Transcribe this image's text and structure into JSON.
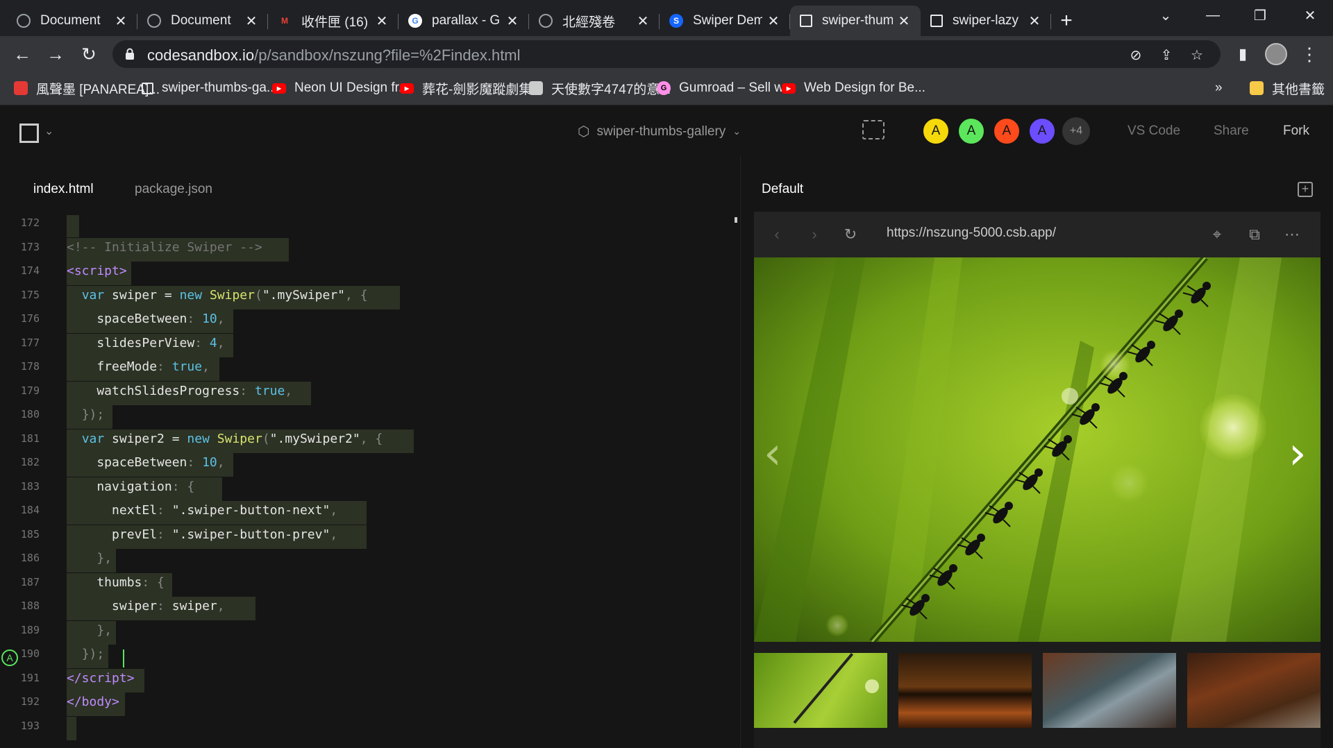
{
  "browser": {
    "tabs": [
      {
        "title": "Document",
        "icon": "globe-icon",
        "active": false
      },
      {
        "title": "Document",
        "icon": "globe-icon",
        "active": false
      },
      {
        "title": "收件匣 (16)",
        "icon": "gmail-icon",
        "active": false
      },
      {
        "title": "parallax - G",
        "icon": "google-icon",
        "active": false
      },
      {
        "title": "北經殘卷",
        "icon": "globe-icon",
        "active": false
      },
      {
        "title": "Swiper Dem",
        "icon": "swiper-icon",
        "active": false
      },
      {
        "title": "swiper-thum",
        "icon": "codesandbox-icon",
        "active": true
      },
      {
        "title": "swiper-lazy",
        "icon": "codesandbox-icon",
        "active": false
      }
    ],
    "url_host": "codesandbox.io",
    "url_path": "/p/sandbox/nszung?file=%2Findex.html",
    "bookmarks": [
      {
        "label": "風聲墨 [PANAREA]...",
        "icon": "panarea-icon",
        "color": "#e53935"
      },
      {
        "label": "swiper-thumbs-ga...",
        "icon": "codesandbox-icon",
        "color": "#e8eaed"
      },
      {
        "label": "Neon UI Design fr...",
        "icon": "youtube-icon",
        "color": "#ff0000"
      },
      {
        "label": "葬花-劍影魔蹤劇集...",
        "icon": "youtube-icon",
        "color": "#ff0000"
      },
      {
        "label": "天使數字4747的意...",
        "icon": "image-icon",
        "color": "#cccccc"
      },
      {
        "label": "Gumroad – Sell w...",
        "icon": "gumroad-icon",
        "color": "#ff90e8"
      },
      {
        "label": "Web Design for Be...",
        "icon": "youtube-icon",
        "color": "#ff0000"
      }
    ],
    "bookmarks_overflow": "»",
    "other_bookmarks": "其他書籤"
  },
  "csb": {
    "sandbox_name": "swiper-thumbs-gallery",
    "avatars": [
      {
        "letter": "A",
        "color": "#f5d90a"
      },
      {
        "letter": "A",
        "color": "#5ce65c"
      },
      {
        "letter": "A",
        "color": "#ff4a1c"
      },
      {
        "letter": "A",
        "color": "#6c4dff"
      }
    ],
    "avatar_more": "+4",
    "vscode_label": "VS Code",
    "share_label": "Share",
    "fork_label": "Fork"
  },
  "editor": {
    "files": [
      "index.html",
      "package.json"
    ],
    "active_file": "index.html",
    "collaborator_marker": "A",
    "lines": [
      {
        "n": "172",
        "html": ""
      },
      {
        "n": "173",
        "html": "<span class='c-comment'>&lt;!-- Initialize Swiper --&gt;</span>"
      },
      {
        "n": "174",
        "html": "<span class='c-tag'>&lt;script&gt;</span>"
      },
      {
        "n": "175",
        "html": "  <span class='c-kw'>var</span> swiper = <span class='c-kw'>new</span> <span class='c-fn'>Swiper</span><span class='c-punct'>(</span>\".mySwiper\"<span class='c-punct'>, {</span>"
      },
      {
        "n": "176",
        "html": "    spaceBetween<span class='c-punct'>:</span> <span class='c-num'>10</span><span class='c-punct'>,</span>"
      },
      {
        "n": "177",
        "html": "    slidesPerView<span class='c-punct'>:</span> <span class='c-num'>4</span><span class='c-punct'>,</span>"
      },
      {
        "n": "178",
        "html": "    freeMode<span class='c-punct'>:</span> <span class='c-kw'>true</span><span class='c-punct'>,</span>"
      },
      {
        "n": "179",
        "html": "    watchSlidesProgress<span class='c-punct'>:</span> <span class='c-kw'>true</span><span class='c-punct'>,</span>"
      },
      {
        "n": "180",
        "html": "  <span class='c-punct'>});</span>"
      },
      {
        "n": "181",
        "html": "  <span class='c-kw'>var</span> swiper2 = <span class='c-kw'>new</span> <span class='c-fn'>Swiper</span><span class='c-punct'>(</span>\".mySwiper2\"<span class='c-punct'>, {</span>"
      },
      {
        "n": "182",
        "html": "    spaceBetween<span class='c-punct'>:</span> <span class='c-num'>10</span><span class='c-punct'>,</span>"
      },
      {
        "n": "183",
        "html": "    navigation<span class='c-punct'>: {</span>"
      },
      {
        "n": "184",
        "html": "      nextEl<span class='c-punct'>:</span> \".swiper-button-next\"<span class='c-punct'>,</span>"
      },
      {
        "n": "185",
        "html": "      prevEl<span class='c-punct'>:</span> \".swiper-button-prev\"<span class='c-punct'>,</span>"
      },
      {
        "n": "186",
        "html": "    <span class='c-punct'>},</span>"
      },
      {
        "n": "187",
        "html": "    thumbs<span class='c-punct'>: {</span>"
      },
      {
        "n": "188",
        "html": "      swiper<span class='c-punct'>:</span> swiper<span class='c-punct'>,</span>"
      },
      {
        "n": "189",
        "html": "    <span class='c-punct'>},</span>"
      },
      {
        "n": "190",
        "html": "  <span class='c-punct'>});</span>"
      },
      {
        "n": "191",
        "html": "<span class='c-tag'>&lt;/script&gt;</span>"
      },
      {
        "n": "192",
        "html": "<span class='c-tag'>&lt;/body&gt;</span>"
      },
      {
        "n": "193",
        "html": ""
      }
    ]
  },
  "preview": {
    "title": "Default",
    "url": "https://nszung-5000.csb.app/"
  }
}
